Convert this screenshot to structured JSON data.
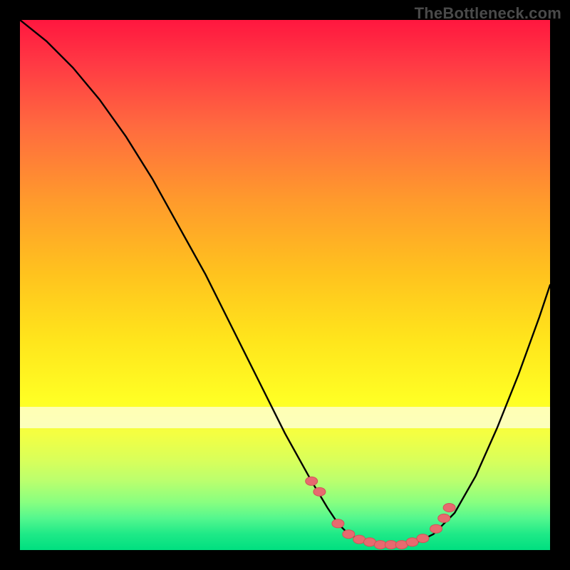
{
  "attribution": "TheBottleneck.com",
  "colors": {
    "frame": "#000000",
    "curve_stroke": "#000000",
    "marker_fill": "#e76a6f",
    "marker_stroke": "#d15358"
  },
  "chart_data": {
    "type": "line",
    "title": "",
    "xlabel": "",
    "ylabel": "",
    "xlim": [
      0,
      100
    ],
    "ylim": [
      0,
      100
    ],
    "series": [
      {
        "name": "bottleneck-curve",
        "x": [
          0,
          5,
          10,
          15,
          20,
          25,
          30,
          35,
          40,
          45,
          50,
          55,
          58,
          60,
          62,
          65,
          68,
          72,
          75,
          78,
          82,
          86,
          90,
          94,
          98,
          100
        ],
        "y": [
          100,
          96,
          91,
          85,
          78,
          70,
          61,
          52,
          42,
          32,
          22,
          13,
          8,
          5,
          3,
          1.5,
          1,
          1,
          1.5,
          3,
          7,
          14,
          23,
          33,
          44,
          50
        ]
      }
    ],
    "markers": {
      "name": "highlight-points",
      "x": [
        55,
        56.5,
        60,
        62,
        64,
        66,
        68,
        70,
        72,
        74,
        76,
        78.5,
        80,
        81
      ],
      "y": [
        13,
        11,
        5,
        3,
        2,
        1.5,
        1,
        1,
        1,
        1.5,
        2.2,
        4,
        6,
        8
      ]
    }
  }
}
